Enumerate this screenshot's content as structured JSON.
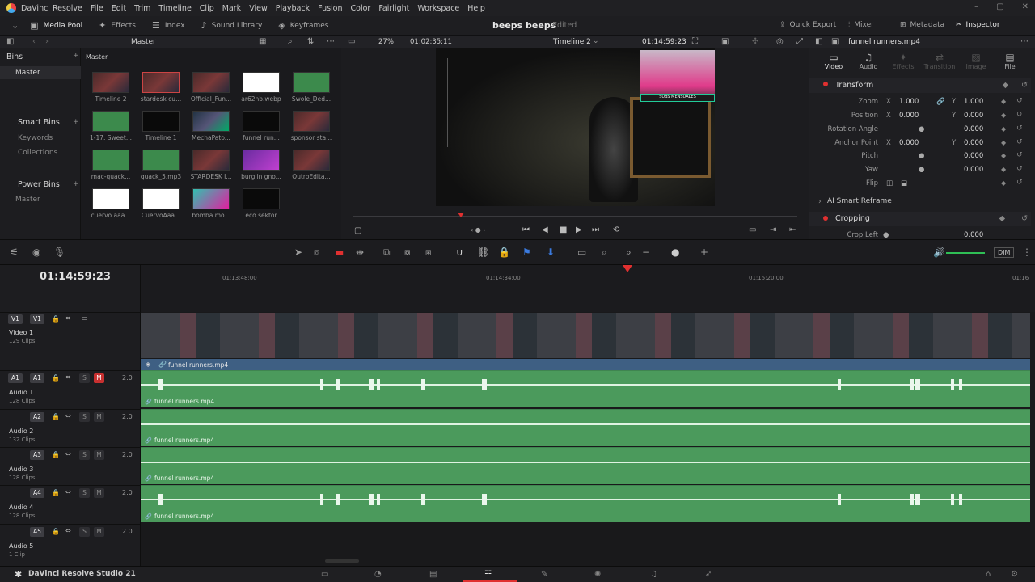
{
  "app": {
    "title": "DaVinci Resolve",
    "product": "DaVinci Resolve Studio 21"
  },
  "menu": [
    "File",
    "Edit",
    "Trim",
    "Timeline",
    "Clip",
    "Mark",
    "View",
    "Playback",
    "Fusion",
    "Color",
    "Fairlight",
    "Workspace",
    "Help"
  ],
  "toolbar": {
    "media_pool": "Media Pool",
    "effects": "Effects",
    "index": "Index",
    "sound_library": "Sound Library",
    "keyframes": "Keyframes",
    "project_title": "beeps beeps",
    "project_status": "Edited",
    "quick_export": "Quick Export",
    "mixer": "Mixer",
    "metadata": "Metadata",
    "inspector": "Inspector"
  },
  "media_pool": {
    "breadcrumb": "Master",
    "bin_path": "Master",
    "bins_header": "Bins",
    "bins": [
      "Master"
    ],
    "smart_bins_header": "Smart Bins",
    "smart_bins": [
      "Keywords",
      "Collections"
    ],
    "power_bins_header": "Power Bins",
    "power_bins": [
      "Master"
    ],
    "clips": [
      {
        "name": "Timeline 2",
        "kind": "video"
      },
      {
        "name": "stardesk cu...",
        "kind": "video"
      },
      {
        "name": "Official_Fun...",
        "kind": "video"
      },
      {
        "name": "ar62nb.webp",
        "kind": "logo"
      },
      {
        "name": "Swole_Ded...",
        "kind": "audio"
      },
      {
        "name": "1-17. Sweet...",
        "kind": "audio"
      },
      {
        "name": "Timeline 1",
        "kind": "black"
      },
      {
        "name": "MechaPato...",
        "kind": "game"
      },
      {
        "name": "funnel run...",
        "kind": "black"
      },
      {
        "name": "sponsor sta...",
        "kind": "video"
      },
      {
        "name": "mac-quack...",
        "kind": "audio"
      },
      {
        "name": "quack_5.mp3",
        "kind": "audio"
      },
      {
        "name": "STARDESK I...",
        "kind": "video"
      },
      {
        "name": "burglin gno...",
        "kind": "purple"
      },
      {
        "name": "OutroEdita...",
        "kind": "video"
      },
      {
        "name": "cuervo aaa...",
        "kind": "logo"
      },
      {
        "name": "CuervoAaa...",
        "kind": "logo"
      },
      {
        "name": "bomba mo...",
        "kind": "cyan"
      },
      {
        "name": "eco sektor",
        "kind": "black"
      }
    ]
  },
  "viewer": {
    "zoom": "27%",
    "source_timecode": "01:02:35:11",
    "timeline_name": "Timeline 2",
    "record_timecode": "01:14:59:23",
    "overlay_subs": "SUBS MENSUALES"
  },
  "inspector": {
    "clip_name": "funnel runners.mp4",
    "tabs": [
      "Video",
      "Audio",
      "Effects",
      "Transition",
      "Image",
      "File"
    ],
    "transform_title": "Transform",
    "params": [
      {
        "name": "Zoom",
        "x": "1.000",
        "y": "1.000"
      },
      {
        "name": "Position",
        "x": "0.000",
        "y": "0.000"
      },
      {
        "name": "Rotation Angle",
        "v": "0.000"
      },
      {
        "name": "Anchor Point",
        "x": "0.000",
        "y": "0.000"
      },
      {
        "name": "Pitch",
        "v": "0.000"
      },
      {
        "name": "Yaw",
        "v": "0.000"
      },
      {
        "name": "Flip"
      }
    ],
    "ai_reframe": "AI Smart Reframe",
    "cropping": "Cropping",
    "crop_left": {
      "name": "Crop Left",
      "v": "0.000"
    }
  },
  "timeline": {
    "timecode": "01:14:59:23",
    "ruler_ticks": [
      "01:13:48:00",
      "01:14:34:00",
      "01:15:20:00",
      "01:16"
    ],
    "video_track": {
      "id": "V1",
      "name": "Video 1",
      "count": "129 Clips",
      "clip_name": "funnel runners.mp4"
    },
    "audio_tracks": [
      {
        "id": "A1",
        "name": "Audio 1",
        "count": "128 Clips",
        "level": "2.0",
        "clip_name": "funnel runners.mp4"
      },
      {
        "id": "A2",
        "name": "Audio 2",
        "count": "132 Clips",
        "level": "2.0",
        "clip_name": "funnel runners.mp4"
      },
      {
        "id": "A3",
        "name": "Audio 3",
        "count": "128 Clips",
        "level": "2.0",
        "clip_name": "funnel runners.mp4"
      },
      {
        "id": "A4",
        "name": "Audio 4",
        "count": "128 Clips",
        "level": "2.0",
        "clip_name": "funnel runners.mp4"
      },
      {
        "id": "A5",
        "name": "Audio 5",
        "count": "1 Clip",
        "level": "2.0"
      }
    ],
    "solo_label": "S",
    "mute_label": "M",
    "dim_label": "DIM"
  },
  "colors": {
    "accent_red": "#e03030",
    "audio_green": "#4b9a5c",
    "video_label_blue": "#3e5f83"
  }
}
